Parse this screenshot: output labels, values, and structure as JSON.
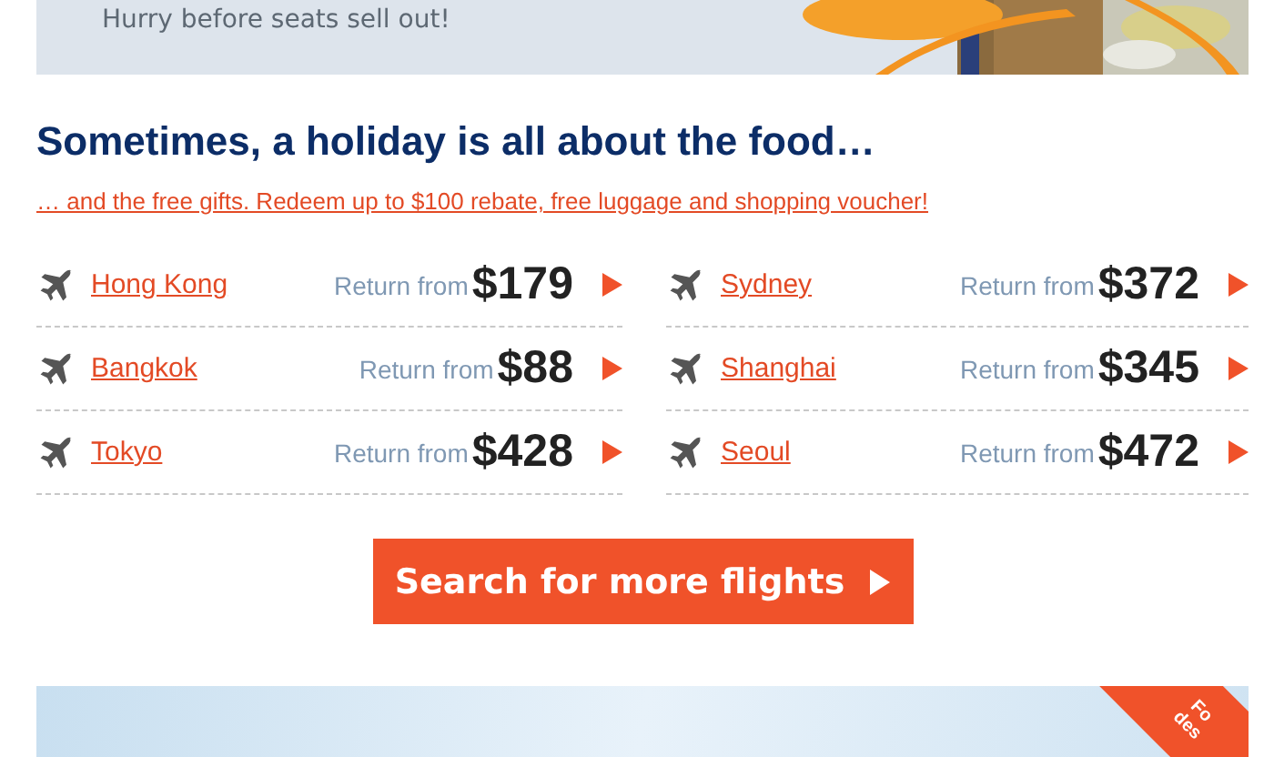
{
  "top_banner": {
    "text": "Hurry before seats sell out!"
  },
  "heading": "Sometimes, a holiday is all about the food…",
  "subheading": "… and the free gifts. Redeem up to $100 rebate, free luggage and shopping voucher!",
  "flights": [
    {
      "city": "Hong Kong",
      "label": "Return from",
      "price": "$179"
    },
    {
      "city": "Sydney",
      "label": "Return from",
      "price": "$372"
    },
    {
      "city": "Bangkok",
      "label": "Return from",
      "price": "$88"
    },
    {
      "city": "Shanghai",
      "label": "Return from",
      "price": "$345"
    },
    {
      "city": "Tokyo",
      "label": "Return from",
      "price": "$428"
    },
    {
      "city": "Seoul",
      "label": "Return from",
      "price": "$472"
    }
  ],
  "search_button": "Search for more flights",
  "bottom_banner": {
    "ribbon": [
      "Fo",
      "des"
    ]
  }
}
